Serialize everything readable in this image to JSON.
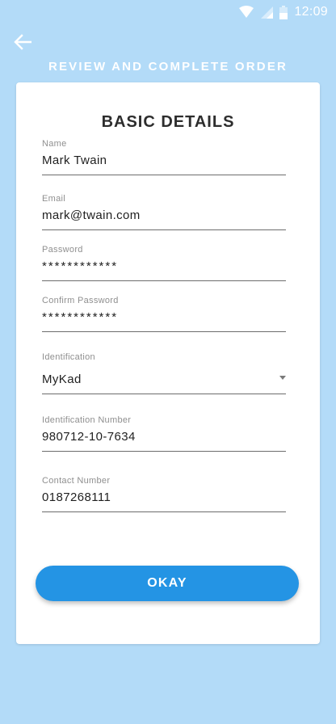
{
  "status_bar": {
    "time": "12:09",
    "icons": [
      "wifi-icon",
      "signal-icon",
      "battery-icon"
    ]
  },
  "header": {
    "back_icon": "arrow-left-icon",
    "title": "REVIEW AND COMPLETE ORDER"
  },
  "card": {
    "title": "BASIC DETAILS",
    "fields": {
      "name": {
        "label": "Name",
        "value": "Mark Twain"
      },
      "email": {
        "label": "Email",
        "value": "mark@twain.com"
      },
      "password": {
        "label": "Password",
        "value": "************"
      },
      "confirm_password": {
        "label": "Confirm Password",
        "value": "************"
      },
      "identification": {
        "label": "Identification",
        "value": "MyKad"
      },
      "identification_number": {
        "label": "Identification Number",
        "value": "980712-10-7634"
      },
      "contact_number": {
        "label": "Contact Number",
        "value": "0187268111"
      }
    },
    "okay_label": "OKAY"
  },
  "colors": {
    "background": "#b3dbf8",
    "accent": "#2494e4",
    "card": "#ffffff"
  }
}
